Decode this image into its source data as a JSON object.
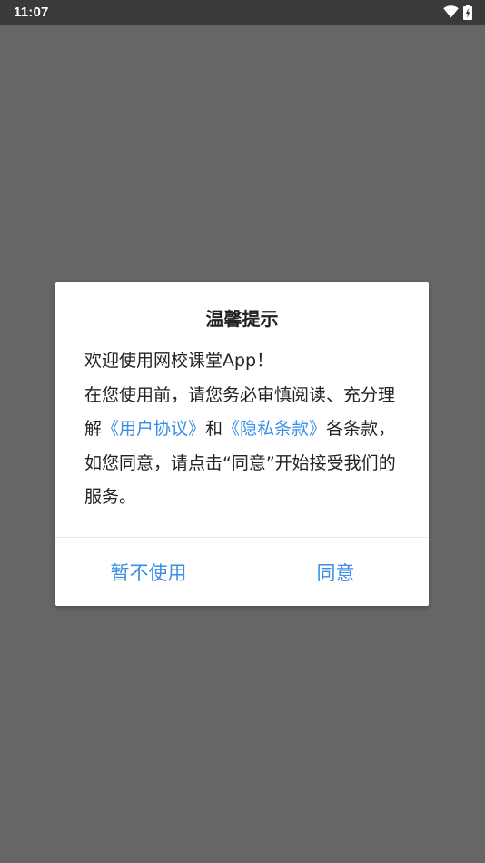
{
  "status_bar": {
    "time": "11:07",
    "icons": [
      "wifi-icon",
      "battery-charging-icon"
    ]
  },
  "dialog": {
    "title": "温馨提示",
    "line1": "欢迎使用网校课堂App！",
    "line2_part1": "在您使用前，请您务必审慎阅读、充分理解",
    "user_agreement_link": "《用户协议》",
    "connector": "和",
    "privacy_link": "《隐私条款》",
    "line2_part2": "各条款，如您同意，请点击“同意”开始接受我们的服务。",
    "decline_button": "暂不使用",
    "agree_button": "同意"
  },
  "colors": {
    "overlay": "#666666",
    "status_bar": "#3a3a3a",
    "link": "#3a8ee6",
    "button_text": "#3a8ee6",
    "dialog_bg": "#ffffff"
  }
}
